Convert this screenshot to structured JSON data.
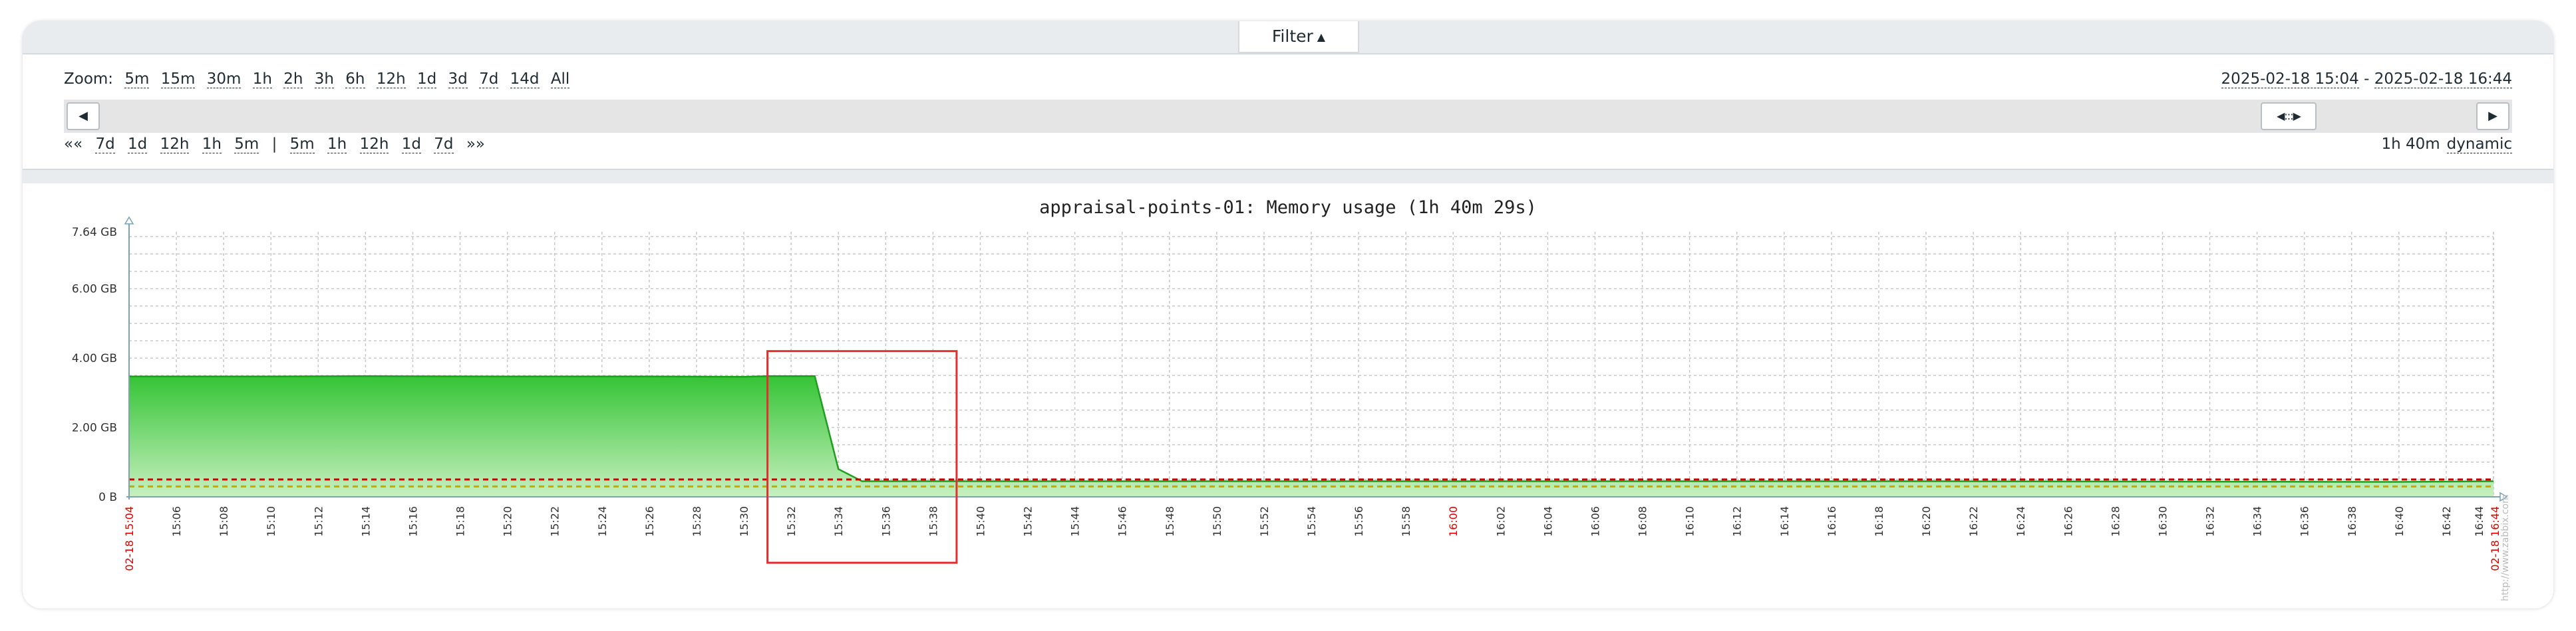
{
  "filter": {
    "label": "Filter"
  },
  "zoom": {
    "label": "Zoom:",
    "options": [
      "5m",
      "15m",
      "30m",
      "1h",
      "2h",
      "3h",
      "6h",
      "12h",
      "1d",
      "3d",
      "7d",
      "14d",
      "All"
    ]
  },
  "period": {
    "from": "2025-02-18 15:04",
    "separator": " - ",
    "to": "2025-02-18 16:44"
  },
  "nav": {
    "back_all": "««",
    "back": [
      "7d",
      "1d",
      "12h",
      "1h",
      "5m"
    ],
    "divider": "|",
    "forward": [
      "5m",
      "1h",
      "12h",
      "1d",
      "7d"
    ],
    "forward_all": "»»"
  },
  "duration": {
    "value": "1h 40m",
    "mode": "dynamic"
  },
  "colors": {
    "area": "#35c435",
    "area_light": "#c8f0c0",
    "trigger_red": "#cc0000",
    "trigger_yellow": "#c8a800",
    "highlight": "#e03030",
    "accent": "#e00000"
  },
  "chart_data": {
    "type": "area",
    "title": "appraisal-points-01: Memory usage (1h 40m 29s)",
    "xlabel": "",
    "ylabel": "",
    "ylim": [
      0,
      7.64
    ],
    "y_unit": "GB",
    "y_ticks": [
      {
        "value": 0,
        "label": "0 B"
      },
      {
        "value": 2,
        "label": "2.00 GB"
      },
      {
        "value": 4,
        "label": "4.00 GB"
      },
      {
        "value": 6,
        "label": "6.00 GB"
      },
      {
        "value": 7.64,
        "label": "7.64 GB"
      }
    ],
    "x_range": [
      "15:04",
      "16:44"
    ],
    "x_ticks": [
      "02-18 15:04",
      "15:06",
      "15:08",
      "15:10",
      "15:12",
      "15:14",
      "15:16",
      "15:18",
      "15:20",
      "15:22",
      "15:24",
      "15:26",
      "15:28",
      "15:30",
      "15:32",
      "15:34",
      "15:36",
      "15:38",
      "15:40",
      "15:42",
      "15:44",
      "15:46",
      "15:48",
      "15:50",
      "15:52",
      "15:54",
      "15:56",
      "15:58",
      "16:00",
      "16:02",
      "16:04",
      "16:06",
      "16:08",
      "16:10",
      "16:12",
      "16:14",
      "16:16",
      "16:18",
      "16:20",
      "16:22",
      "16:24",
      "16:26",
      "16:28",
      "16:30",
      "16:32",
      "16:34",
      "16:36",
      "16:38",
      "16:40",
      "16:42",
      "16:44",
      "02-18 16:44"
    ],
    "red_ticks": [
      "02-18 15:04",
      "16:00",
      "02-18 16:44"
    ],
    "series": [
      {
        "values": [
          {
            "x": "15:04",
            "y": 3.47
          },
          {
            "x": "15:10",
            "y": 3.47
          },
          {
            "x": "15:14",
            "y": 3.48
          },
          {
            "x": "15:20",
            "y": 3.47
          },
          {
            "x": "15:26",
            "y": 3.47
          },
          {
            "x": "15:30",
            "y": 3.46
          },
          {
            "x": "15:31",
            "y": 3.48
          },
          {
            "x": "15:33",
            "y": 3.48
          },
          {
            "x": "15:34",
            "y": 0.8
          },
          {
            "x": "15:35",
            "y": 0.45
          },
          {
            "x": "15:40",
            "y": 0.45
          },
          {
            "x": "16:00",
            "y": 0.45
          },
          {
            "x": "16:20",
            "y": 0.45
          },
          {
            "x": "16:40",
            "y": 0.43
          },
          {
            "x": "16:44",
            "y": 0.45
          }
        ]
      }
    ],
    "thresholds": [
      {
        "y": 0.5,
        "color": "red",
        "style": "dashed"
      },
      {
        "y": 0.3,
        "color": "yellow",
        "style": "dashed"
      }
    ],
    "highlight_box": {
      "x_from": "15:31",
      "x_to": "15:39",
      "y_from": -1.9,
      "y_to": 4.2
    },
    "grid": true,
    "watermark": "http://www.zabbix.com"
  }
}
